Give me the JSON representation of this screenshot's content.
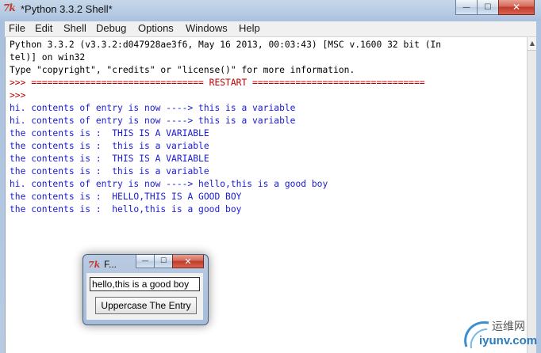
{
  "window": {
    "icon": "tk-feather-icon",
    "title": "*Python 3.3.2 Shell*",
    "buttons": {
      "minimize": "—",
      "maximize": "☐",
      "close": "✕"
    }
  },
  "menu": [
    "File",
    "Edit",
    "Shell",
    "Debug",
    "Options",
    "Windows",
    "Help"
  ],
  "colors": {
    "output_blue": "#1a1ad4",
    "prompt_red": "#c00000",
    "stdout_black": "#000000"
  },
  "shell_lines": [
    {
      "text": "Python 3.3.2 (v3.3.2:d047928ae3f6, May 16 2013, 00:03:43) [MSC v.1600 32 bit (In",
      "color": "#000000"
    },
    {
      "text": "tel)] on win32",
      "color": "#000000"
    },
    {
      "text": "Type \"copyright\", \"credits\" or \"license()\" for more information.",
      "color": "#000000"
    },
    {
      "text": ">>> ================================ RESTART ================================",
      "color": "#c00000"
    },
    {
      "text": ">>>",
      "color": "#c00000"
    },
    {
      "text": "hi. contents of entry is now ----> this is a variable",
      "color": "#1a1ad4"
    },
    {
      "text": "hi. contents of entry is now ----> this is a variable",
      "color": "#1a1ad4"
    },
    {
      "text": "the contents is :  THIS IS A VARIABLE",
      "color": "#1a1ad4"
    },
    {
      "text": "the contents is :  this is a variable",
      "color": "#1a1ad4"
    },
    {
      "text": "the contents is :  THIS IS A VARIABLE",
      "color": "#1a1ad4"
    },
    {
      "text": "the contents is :  this is a variable",
      "color": "#1a1ad4"
    },
    {
      "text": "hi. contents of entry is now ----> hello,this is a good boy",
      "color": "#1a1ad4"
    },
    {
      "text": "the contents is :  HELLO,THIS IS A GOOD BOY",
      "color": "#1a1ad4"
    },
    {
      "text": "the contents is :  hello,this is a good boy",
      "color": "#1a1ad4"
    }
  ],
  "mini_window": {
    "title": "F...",
    "entry_value": "hello,this is a good boy",
    "button_label": "Uppercase The Entry"
  },
  "watermark": {
    "cn": "运维网",
    "en": "iyunv.com"
  }
}
